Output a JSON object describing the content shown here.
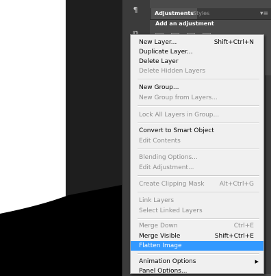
{
  "panel": {
    "tabs": [
      {
        "label": "Adjustments",
        "active": true
      },
      {
        "label": "Styles",
        "active": false
      }
    ],
    "heading": "Add an adjustment"
  },
  "menu": {
    "items": [
      {
        "label": "New Layer...",
        "shortcut": "Shift+Ctrl+N",
        "enabled": true
      },
      {
        "label": "Duplicate Layer...",
        "shortcut": "",
        "enabled": true
      },
      {
        "label": "Delete Layer",
        "shortcut": "",
        "enabled": true
      },
      {
        "label": "Delete Hidden Layers",
        "shortcut": "",
        "enabled": false
      },
      {
        "label": "New Group...",
        "shortcut": "",
        "enabled": true
      },
      {
        "label": "New Group from Layers...",
        "shortcut": "",
        "enabled": false
      },
      {
        "label": "Lock All Layers in Group...",
        "shortcut": "",
        "enabled": false
      },
      {
        "label": "Convert to Smart Object",
        "shortcut": "",
        "enabled": true
      },
      {
        "label": "Edit Contents",
        "shortcut": "",
        "enabled": false
      },
      {
        "label": "Blending Options...",
        "shortcut": "",
        "enabled": false
      },
      {
        "label": "Edit Adjustment...",
        "shortcut": "",
        "enabled": false
      },
      {
        "label": "Create Clipping Mask",
        "shortcut": "Alt+Ctrl+G",
        "enabled": false
      },
      {
        "label": "Link Layers",
        "shortcut": "",
        "enabled": false
      },
      {
        "label": "Select Linked Layers",
        "shortcut": "",
        "enabled": false
      },
      {
        "label": "Merge Down",
        "shortcut": "Ctrl+E",
        "enabled": false
      },
      {
        "label": "Merge Visible",
        "shortcut": "Shift+Ctrl+E",
        "enabled": true
      },
      {
        "label": "Flatten Image",
        "shortcut": "",
        "enabled": true,
        "selected": true
      },
      {
        "label": "Animation Options",
        "shortcut": "",
        "enabled": true,
        "submenu": true
      },
      {
        "label": "Panel Options...",
        "shortcut": "",
        "enabled": true
      }
    ]
  },
  "colors": {
    "menu_bg": "#f0f0f0",
    "highlight": "#3399ff",
    "disabled_text": "#8d8d8d",
    "panel_bg": "#4a4a4a"
  }
}
